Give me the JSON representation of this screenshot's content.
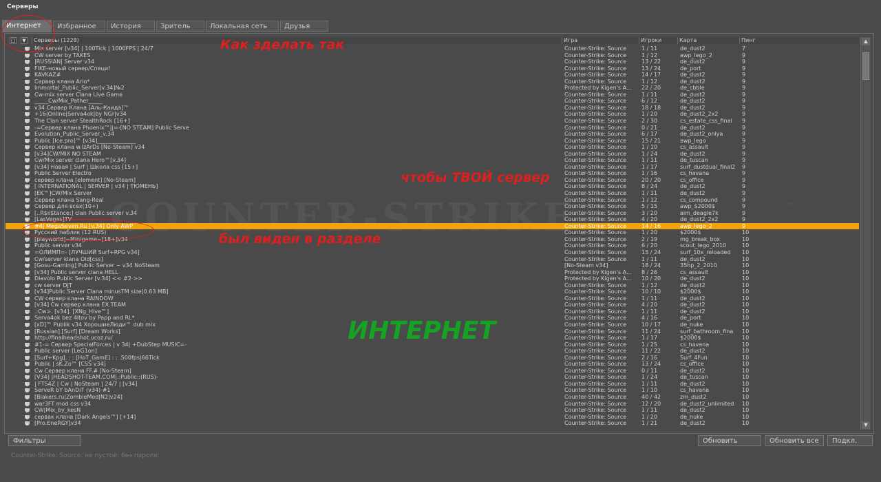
{
  "window": {
    "title": "Серверы"
  },
  "tabs": [
    "Интернет",
    "Избранное",
    "История",
    "Зритель",
    "Локальная сеть",
    "Друзья"
  ],
  "columns": {
    "name": "Серверы (1228)",
    "game": "Игра",
    "players": "Игроки",
    "map": "Карта",
    "ping": "Пинг"
  },
  "servers": [
    {
      "name": "Mix server [v34] | 100Tick | 1000FPS | 24/7",
      "game": "Counter-Strike: Source",
      "players": "1 / 11",
      "map": "de_dust2",
      "ping": "7"
    },
    {
      "name": "CW server by TAKES",
      "game": "Counter-Strike: Source",
      "players": "1 / 12",
      "map": "awp_lego_2",
      "ping": "9"
    },
    {
      "name": "|RUSSIAN| Server v34",
      "game": "Counter-Strike: Source",
      "players": "13 / 22",
      "map": "de_dust2",
      "ping": "9"
    },
    {
      "name": "FIKE-новый сервер/Специ!",
      "game": "Counter-Strike: Source",
      "players": "13 / 24",
      "map": "de_port",
      "ping": "9"
    },
    {
      "name": "KAVKAZ#",
      "game": "Counter-Strike: Source",
      "players": "14 / 17",
      "map": "de_dust2",
      "ping": "9"
    },
    {
      "name": "Сервер клана Ario*",
      "game": "Counter-Strike: Source",
      "players": "1 / 12",
      "map": "de_dust2",
      "ping": "9"
    },
    {
      "name": "Immortal_Public_Server[v.34]№2",
      "game": "Protected by Kigen's A...",
      "players": "22 / 20",
      "map": "de_cbble",
      "ping": "9"
    },
    {
      "name": "Cw-mix server Clana Live Game",
      "game": "Counter-Strike: Source",
      "players": "1 / 11",
      "map": "de_dust2",
      "ping": "9"
    },
    {
      "name": "_____Cw/Mix_Pather_____",
      "game": "Counter-Strike: Source",
      "players": "6 / 12",
      "map": "de_dust2",
      "ping": "9"
    },
    {
      "name": "v34 Сервер Клана [Аль-Каида]™",
      "game": "Counter-Strike: Source",
      "players": "18 / 18",
      "map": "de_dust2",
      "ping": "9"
    },
    {
      "name": "+16|Online|Serva4ok|by NGr|v34",
      "game": "Counter-Strike: Source",
      "players": "1 / 20",
      "map": "de_dust2_2x2",
      "ping": "9"
    },
    {
      "name": "The Clan server StealthRock [16+]",
      "game": "Counter-Strike: Source",
      "players": "2 / 30",
      "map": "cs_estate_css_final",
      "ping": "9"
    },
    {
      "name": "-=Сервер клана Phoenix™||=-[NO STEAM] Public Serve",
      "game": "Counter-Strike: Source",
      "players": "0 / 21",
      "map": "de_dust2",
      "ping": "9"
    },
    {
      "name": "Evolution_Public_Server_v.34",
      "game": "Counter-Strike: Source",
      "players": "6 / 17",
      "map": "de_dust2_onlya",
      "ping": "9"
    },
    {
      "name": "Public [Ice.pro]™ [v34]______________",
      "game": "Counter-Strike: Source",
      "players": "15 / 21",
      "map": "awp_lego",
      "ping": "9"
    },
    {
      "name": "Сервер клана w.IzArDs [No-Steam] v34",
      "game": "Counter-Strike: Source",
      "players": "1 / 10",
      "map": "cs_assault",
      "ping": "9"
    },
    {
      "name": "[v34]CW/MIX NO STEAM",
      "game": "Counter-Strike: Source",
      "players": "1 / 24",
      "map": "de_dust2",
      "ping": "9"
    },
    {
      "name": "Cw/Mix server clana Hero™[v.34]",
      "game": "Counter-Strike: Source",
      "players": "1 / 11",
      "map": "de_tuscan",
      "ping": "9"
    },
    {
      "name": "[v34] Новая | Surf | Школа css [15+]",
      "game": "Counter-Strike: Source",
      "players": "1 / 17",
      "map": "surf_dustdual_final2",
      "ping": "9"
    },
    {
      "name": "Public Server Electro",
      "game": "Counter-Strike: Source",
      "players": "1 / 16",
      "map": "cs_havana",
      "ping": "9"
    },
    {
      "name": "сервер клана [element] [No-Steam]",
      "game": "Counter-Strike: Source",
      "players": "20 / 20",
      "map": "cs_office",
      "ping": "9"
    },
    {
      "name": "[ INTERNATIONAL | SERVER | v34 | ТЮМЕНЬ]",
      "game": "Counter-Strike: Source",
      "players": "8 / 24",
      "map": "de_dust2",
      "ping": "9"
    },
    {
      "name": "[EK™]CW/Mix Server",
      "game": "Counter-Strike: Source",
      "players": "1 / 11",
      "map": "de_dust2",
      "ping": "9"
    },
    {
      "name": "Сервер клана Sang-Real",
      "game": "Counter-Strike: Source",
      "players": "1 / 12",
      "map": "cs_compound",
      "ping": "9"
    },
    {
      "name": "Сервер для всех(10+)",
      "game": "Counter-Strike: Source",
      "players": "5 / 15",
      "map": "awp_$2000$",
      "ping": "9"
    },
    {
      "name": "[..R$ii$tance:] clan Public server v.34",
      "game": "Counter-Strike: Source",
      "players": "3 / 20",
      "map": "aim_deagle7k",
      "ping": "9"
    },
    {
      "name": "[LasVegas]TV",
      "game": "Counter-Strike: Source",
      "players": "4 / 20",
      "map": "de_dust2_2x2",
      "ping": "9"
    },
    {
      "name": "#4| MegaSeven.Ru [v.34] Only AWP",
      "game": "Counter-Strike: Source",
      "players": "14 / 16",
      "map": "awp_lego_2",
      "ping": "9",
      "selected": true
    },
    {
      "name": "Русский паблик (12 RUS)",
      "game": "Counter-Strike: Source",
      "players": "1 / 20",
      "map": "$2000$",
      "ping": "10"
    },
    {
      "name": "[playworld]~Minigame~[18+]v34",
      "game": "Counter-Strike: Source",
      "players": "2 / 19",
      "map": "mg_break_box",
      "ping": "10"
    },
    {
      "name": "Public server v34",
      "game": "Counter-Strike: Source",
      "players": "6 / 20",
      "map": "scout_lego_2010",
      "ping": "10"
    },
    {
      "name": "=ОЛИМП=- [ЛУЧШИЙ Surf+RPG v34]",
      "game": "Counter-Strike: Source",
      "players": "15 / 24",
      "map": "surf_10x_reloaded",
      "ping": "10"
    },
    {
      "name": "Cw/server klana Old[css]",
      "game": "Counter-Strike: Source",
      "players": "1 / 11",
      "map": "de_dust2",
      "ping": "10"
    },
    {
      "name": "[Gosu-Gaming] Public Server ~ v34 NoSteam",
      "game": "[No-Steam v34]",
      "players": "18 / 24",
      "map": "35hp_2_2010",
      "ping": "10"
    },
    {
      "name": "[v34] Public server clana HELL",
      "game": "Protected by Kigen's A...",
      "players": "8 / 26",
      "map": "cs_assault",
      "ping": "10"
    },
    {
      "name": "Diavolo Public Server [v.34] << #2 >>",
      "game": "Protected by Kigen's A...",
      "players": "10 / 20",
      "map": "de_dust2",
      "ping": "10"
    },
    {
      "name": "cw server DJT",
      "game": "Counter-Strike: Source",
      "players": "1 / 12",
      "map": "de_dust2",
      "ping": "10"
    },
    {
      "name": "[v34]Public Server Clana minusTM size[0.63 MB]",
      "game": "Counter-Strike: Source",
      "players": "10 / 10",
      "map": "$2000$",
      "ping": "10"
    },
    {
      "name": "CW сервер клана RAINDOW",
      "game": "Counter-Strike: Source",
      "players": "1 / 11",
      "map": "de_dust2",
      "ping": "10"
    },
    {
      "name": "[v34] Cw сервер клана EX.TEAM",
      "game": "Counter-Strike: Source",
      "players": "4 / 20",
      "map": "de_dust2",
      "ping": "10"
    },
    {
      "name": ".:Cw>. [v34]. [XNg_Hive™]",
      "game": "Counter-Strike: Source",
      "players": "1 / 11",
      "map": "de_dust2",
      "ping": "10"
    },
    {
      "name": "Serva4ok bez 4itov by Papp and RL*",
      "game": "Counter-Strike: Source",
      "players": "4 / 16",
      "map": "de_port",
      "ping": "10"
    },
    {
      "name": "[xD]™ Publik v34 ХорошиеЛюди™ dub mix",
      "game": "Counter-Strike: Source",
      "players": "10 / 17",
      "map": "de_nuke",
      "ping": "10"
    },
    {
      "name": "[Russian]  [Surf]  [Dream Works]",
      "game": "Counter-Strike: Source",
      "players": "11 / 24",
      "map": "surf_bathroom_fina",
      "ping": "10"
    },
    {
      "name": "http://finalheadshot.ucoz.ru/",
      "game": "Counter-Strike: Source",
      "players": "1 / 17",
      "map": "$2000$",
      "ping": "10"
    },
    {
      "name": "#1-= Сервер SpecialForces | v 34| +DubStep MUSIC=-",
      "game": "Counter-Strike: Source",
      "players": "1 / 25",
      "map": "cs_havana",
      "ping": "10"
    },
    {
      "name": "Public server [LeG1on]",
      "game": "Counter-Strike: Source",
      "players": "11 / 22",
      "map": "de_dust2",
      "ping": "10"
    },
    {
      "name": "[Surf+Kpg]. : : [HoT_GamE] : : .500fps|66Tick",
      "game": "Counter-Strike: Source",
      "players": "2 / 16",
      "map": "Surf_4Fun",
      "ping": "10"
    },
    {
      "name": "Public | sK.Zo™ [CSS v34]",
      "game": "Counter-Strike: Source",
      "players": "13 / 24",
      "map": "cs_office",
      "ping": "10"
    },
    {
      "name": "Cw Сервер клана FF.# [No-Steam]",
      "game": "Counter-Strike: Source",
      "players": "0 / 11",
      "map": "de_dust2",
      "ping": "10"
    },
    {
      "name": "[V34] |HEADSHOT-TEAM.COM|.:Public::(RUS)-",
      "game": "Counter-Strike: Source",
      "players": "1 / 24",
      "map": "de_tuscan",
      "ping": "10"
    },
    {
      "name": "| FTS4Z | Cw | NoSteam | 24/7 | [v34]",
      "game": "Counter-Strike: Source",
      "players": "1 / 11",
      "map": "de_dust2",
      "ping": "10"
    },
    {
      "name": "ServeR bY bAnDiT (v34) #1",
      "game": "Counter-Strike: Source",
      "players": "1 / 10",
      "map": "cs_havana",
      "ping": "10"
    },
    {
      "name": "[Blakers.ru|ZombieMod|N2|v24]",
      "game": "Counter-Strike: Source",
      "players": "40 / 42",
      "map": "zm_dust2",
      "ping": "10"
    },
    {
      "name": "war3FT mod css v34",
      "game": "Counter-Strike: Source",
      "players": "12 / 20",
      "map": "de_dust2_unlimited",
      "ping": "10"
    },
    {
      "name": "CW|Mix_by_kesN",
      "game": "Counter-Strike: Source",
      "players": "1 / 11",
      "map": "de_dust2",
      "ping": "10"
    },
    {
      "name": "сервак клана [Dark Angels™] [+14]",
      "game": "Counter-Strike: Source",
      "players": "1 / 20",
      "map": "de_nuke",
      "ping": "10"
    },
    {
      "name": "[Pro.EneRGY]v34",
      "game": "Counter-Strike: Source",
      "players": "1 / 21",
      "map": "de_dust2",
      "ping": "10"
    }
  ],
  "background_logo": {
    "text": "COUNTER-STRIKE",
    "tm": "™"
  },
  "annotations": {
    "line1": "Как зделать так",
    "line2": "чтобы ТВОЙ сервер",
    "line3": "был виден в разделе",
    "line4": "ИНТЕРНЕТ"
  },
  "buttons": {
    "filters": "Фильтры",
    "refresh": "Обновить",
    "refresh_all": "Обновить все",
    "connect": "Подкл."
  },
  "status": "Counter-Strike: Source; не пустой; без пароля;",
  "colors": {
    "selected_row": "#f0a30a",
    "annotation_red": "#e0201e",
    "annotation_green": "#16a324"
  }
}
